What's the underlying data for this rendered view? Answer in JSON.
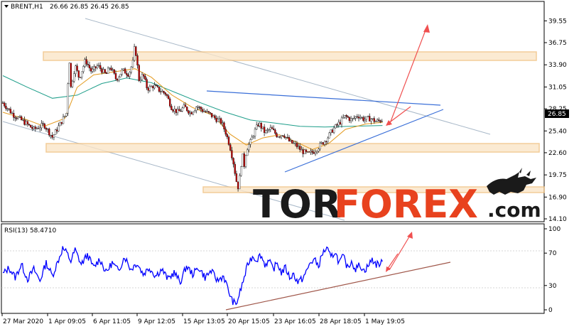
{
  "header": {
    "symbol": "BRENT,H1",
    "ohlc": "26.66 26.85 26.45 26.85",
    "rsi_label": "RSI(13) 58.4710"
  },
  "logo": {
    "part1": "TOR",
    "part2": "FOREX",
    "part3": ".com",
    "bull_icon": "bull-icon"
  },
  "colors": {
    "candle_up": "#c00000",
    "candle_wick": "#202020",
    "ma_fast": "#e39a1e",
    "ma_slow": "#1e9e8a",
    "rsi_line": "#0000ff",
    "channel": "#a8b8c8",
    "trend_blue": "#3a6fd8",
    "zone": "#f0c080",
    "forecast_arrow": "#f05050",
    "rsi_trend": "#a0574a",
    "last_price_bg": "#000000"
  },
  "chart_data": [
    {
      "type": "candlestick",
      "title": "BRENT,H1",
      "ylim": [
        14.1,
        40.95
      ],
      "y_ticks": [
        "39.55",
        "36.75",
        "33.90",
        "31.05",
        "28.25",
        "25.40",
        "22.60",
        "19.75",
        "16.90",
        "14.10"
      ],
      "last_price": "26.85",
      "x_labels": [
        "27 Mar 2020",
        "1 Apr 09:05",
        "6 Apr 11:05",
        "9 Apr 12:05",
        "15 Apr 13:05",
        "20 Apr 15:05",
        "23 Apr 16:05",
        "28 Apr 18:05",
        "1 May 19:05"
      ],
      "close_path": [
        [
          0,
          29.0
        ],
        [
          5,
          27.5
        ],
        [
          10,
          26.6
        ],
        [
          15,
          25.6
        ],
        [
          20,
          26.2
        ],
        [
          24,
          24.6
        ],
        [
          28,
          26.4
        ],
        [
          31,
          27.8
        ],
        [
          32,
          35.5
        ],
        [
          33,
          31.0
        ],
        [
          35,
          33.8
        ],
        [
          37,
          32.2
        ],
        [
          40,
          34.5
        ],
        [
          43,
          33.0
        ],
        [
          46,
          33.8
        ],
        [
          50,
          32.6
        ],
        [
          52,
          33.7
        ],
        [
          55,
          32.0
        ],
        [
          58,
          33.2
        ],
        [
          61,
          32.7
        ],
        [
          63,
          34.2
        ],
        [
          64,
          36.5
        ],
        [
          66,
          32.0
        ],
        [
          68,
          32.6
        ],
        [
          70,
          30.8
        ],
        [
          73,
          31.2
        ],
        [
          76,
          30.6
        ],
        [
          79,
          30.2
        ],
        [
          82,
          28.3
        ],
        [
          85,
          27.8
        ],
        [
          88,
          28.5
        ],
        [
          91,
          27.7
        ],
        [
          94,
          28.6
        ],
        [
          97,
          28.0
        ],
        [
          100,
          27.6
        ],
        [
          103,
          27.0
        ],
        [
          106,
          26.5
        ],
        [
          108,
          25.2
        ],
        [
          110,
          23.5
        ],
        [
          112,
          21.0
        ],
        [
          113,
          19.2
        ],
        [
          114,
          18.2
        ],
        [
          115,
          19.8
        ],
        [
          116,
          22.5
        ],
        [
          117,
          21.0
        ],
        [
          118,
          23.0
        ],
        [
          120,
          24.0
        ],
        [
          122,
          25.3
        ],
        [
          124,
          26.4
        ],
        [
          127,
          25.2
        ],
        [
          130,
          25.7
        ],
        [
          133,
          24.8
        ],
        [
          136,
          25.0
        ],
        [
          139,
          24.0
        ],
        [
          142,
          23.6
        ],
        [
          145,
          22.8
        ],
        [
          148,
          22.4
        ],
        [
          151,
          22.8
        ],
        [
          154,
          23.6
        ],
        [
          157,
          24.4
        ],
        [
          160,
          25.6
        ],
        [
          163,
          26.4
        ],
        [
          166,
          27.3
        ],
        [
          169,
          26.8
        ],
        [
          172,
          27.4
        ],
        [
          175,
          26.9
        ],
        [
          178,
          27.0
        ],
        [
          181,
          26.6
        ],
        [
          184,
          26.85
        ]
      ],
      "ma_fast": [
        [
          0,
          27.8
        ],
        [
          10,
          27.0
        ],
        [
          20,
          26.0
        ],
        [
          30,
          27.0
        ],
        [
          36,
          31.0
        ],
        [
          44,
          32.6
        ],
        [
          54,
          33.0
        ],
        [
          64,
          33.4
        ],
        [
          72,
          32.3
        ],
        [
          82,
          30.0
        ],
        [
          92,
          28.4
        ],
        [
          102,
          27.4
        ],
        [
          110,
          25.0
        ],
        [
          118,
          23.6
        ],
        [
          126,
          24.5
        ],
        [
          134,
          24.9
        ],
        [
          142,
          24.0
        ],
        [
          150,
          23.0
        ],
        [
          158,
          23.8
        ],
        [
          166,
          25.6
        ],
        [
          176,
          26.3
        ],
        [
          184,
          26.5
        ]
      ],
      "ma_slow": [
        [
          0,
          32.5
        ],
        [
          12,
          31.0
        ],
        [
          24,
          29.6
        ],
        [
          36,
          30.0
        ],
        [
          48,
          31.5
        ],
        [
          60,
          32.2
        ],
        [
          72,
          31.6
        ],
        [
          84,
          30.3
        ],
        [
          96,
          29.0
        ],
        [
          108,
          27.8
        ],
        [
          120,
          26.8
        ],
        [
          132,
          26.4
        ],
        [
          144,
          26.0
        ],
        [
          156,
          25.9
        ],
        [
          168,
          26.0
        ],
        [
          184,
          26.1
        ]
      ],
      "x_range": [
        0,
        184
      ]
    },
    {
      "type": "line",
      "title": "RSI(13) 58.4710",
      "ylim": [
        0,
        100
      ],
      "y_ticks": [
        "100",
        "70",
        "30",
        "0"
      ],
      "series": [
        {
          "name": "RSI(13)",
          "values": [
            [
              0,
              44
            ],
            [
              3,
              52
            ],
            [
              6,
              40
            ],
            [
              9,
              56
            ],
            [
              12,
              38
            ],
            [
              15,
              50
            ],
            [
              18,
              36
            ],
            [
              21,
              58
            ],
            [
              24,
              42
            ],
            [
              27,
              62
            ],
            [
              29,
              76
            ],
            [
              31,
              70
            ],
            [
              33,
              60
            ],
            [
              35,
              74
            ],
            [
              38,
              56
            ],
            [
              41,
              68
            ],
            [
              44,
              52
            ],
            [
              47,
              63
            ],
            [
              50,
              46
            ],
            [
              53,
              58
            ],
            [
              56,
              48
            ],
            [
              59,
              66
            ],
            [
              62,
              50
            ],
            [
              65,
              58
            ],
            [
              68,
              44
            ],
            [
              71,
              52
            ],
            [
              74,
              42
            ],
            [
              77,
              50
            ],
            [
              80,
              38
            ],
            [
              83,
              46
            ],
            [
              86,
              34
            ],
            [
              89,
              54
            ],
            [
              92,
              44
            ],
            [
              95,
              52
            ],
            [
              98,
              40
            ],
            [
              101,
              48
            ],
            [
              104,
              36
            ],
            [
              107,
              42
            ],
            [
              109,
              26
            ],
            [
              111,
              12
            ],
            [
              113,
              6
            ],
            [
              115,
              22
            ],
            [
              117,
              40
            ],
            [
              119,
              58
            ],
            [
              121,
              66
            ],
            [
              123,
              62
            ],
            [
              125,
              68
            ],
            [
              127,
              56
            ],
            [
              129,
              60
            ],
            [
              131,
              50
            ],
            [
              133,
              58
            ],
            [
              135,
              46
            ],
            [
              137,
              52
            ],
            [
              139,
              40
            ],
            [
              141,
              44
            ],
            [
              143,
              34
            ],
            [
              145,
              38
            ],
            [
              147,
              46
            ],
            [
              149,
              58
            ],
            [
              151,
              62
            ],
            [
              153,
              54
            ],
            [
              155,
              70
            ],
            [
              157,
              76
            ],
            [
              159,
              64
            ],
            [
              161,
              72
            ],
            [
              163,
              58
            ],
            [
              165,
              66
            ],
            [
              167,
              52
            ],
            [
              169,
              60
            ],
            [
              171,
              50
            ],
            [
              173,
              56
            ],
            [
              175,
              48
            ],
            [
              177,
              54
            ],
            [
              179,
              62
            ],
            [
              181,
              56
            ],
            [
              184,
              58
            ]
          ]
        }
      ],
      "x_range": [
        0,
        184
      ]
    }
  ]
}
